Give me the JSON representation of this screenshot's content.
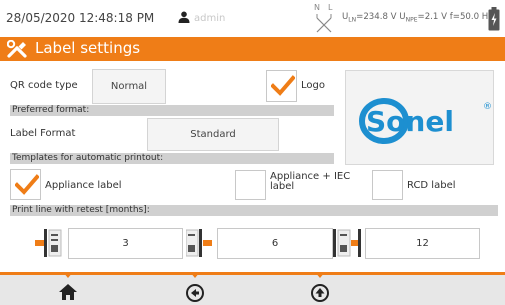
{
  "status": {
    "datetime": "28/05/2020 12:48:18 PM",
    "user": "admin",
    "phase_n": "N",
    "phase_l": "L",
    "uln_label": "U",
    "uln_sub": "LN",
    "uln_value": "=234.8 V",
    "unpe_label": "U",
    "unpe_sub": "NPE",
    "unpe_value": "=2.1 V",
    "freq": "f=50.0 Hz",
    "icons": [
      "user-icon",
      "phase-connection-icon",
      "battery-icon"
    ]
  },
  "header": {
    "title": "Label settings",
    "icon": "tools-icon"
  },
  "qr": {
    "label": "QR code type",
    "value": "Normal"
  },
  "logo": {
    "label": "Logo",
    "checked": true,
    "brand_text": "Sonel",
    "registered": "®"
  },
  "preferred": {
    "section": "Preferred format:",
    "label": "Label Format",
    "value": "Standard"
  },
  "templates": {
    "section": "Templates for automatic printout:",
    "appliance": {
      "label": "Appliance label",
      "checked": true
    },
    "appliance_iec": {
      "label_line1": "Appliance + IEC",
      "label_line2": "label",
      "checked": false
    },
    "rcd": {
      "label": "RCD label",
      "checked": false
    }
  },
  "retest": {
    "section": "Print line with retest [months]:",
    "values": [
      "3",
      "6",
      "12"
    ]
  },
  "nav": {
    "icons": [
      "home-icon",
      "back-icon",
      "up-icon"
    ]
  },
  "colors": {
    "accent": "#ef7d17",
    "brand_blue": "#1d8fd0",
    "section_gray": "#d0d0d0"
  }
}
